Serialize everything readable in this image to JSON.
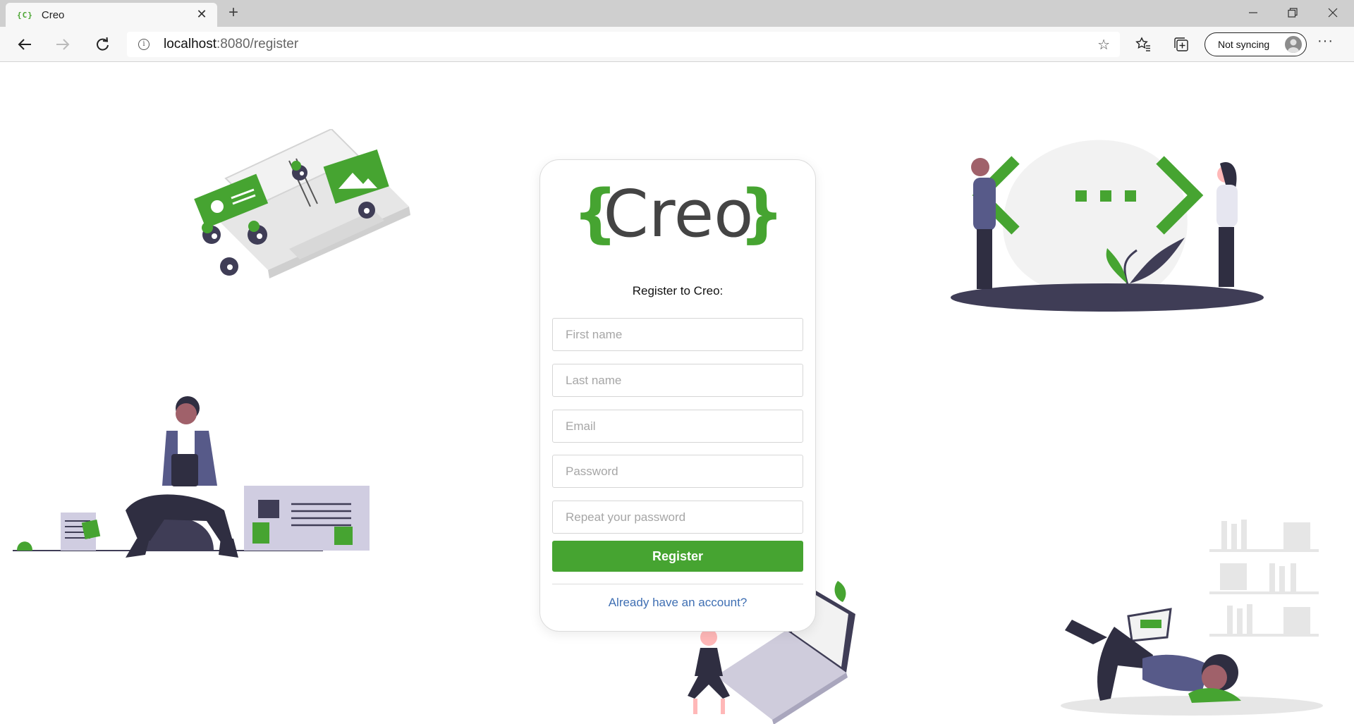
{
  "browser": {
    "tab_title": "Creo",
    "tab_favicon": "{C}",
    "address_host": "localhost",
    "address_path": ":8080/register",
    "sync_label": "Not syncing",
    "more_label": "···"
  },
  "icons": {
    "back": "arrow-left-icon",
    "forward": "arrow-right-icon",
    "refresh": "refresh-icon",
    "info": "info-icon",
    "favorite": "star-icon",
    "favorites_list": "favorites-icon",
    "collections": "collections-icon",
    "profile": "profile-icon"
  },
  "logo": {
    "text": "Creo",
    "brace_open": "{",
    "brace_close": "}",
    "brace_color": "#46a431",
    "text_color": "#444444"
  },
  "form": {
    "heading": "Register to Creo:",
    "first_name_placeholder": "First name",
    "last_name_placeholder": "Last name",
    "email_placeholder": "Email",
    "password_placeholder": "Password",
    "repeat_password_placeholder": "Repeat your password",
    "submit_label": "Register",
    "login_link": "Already have an account?"
  },
  "colors": {
    "accent": "#46a431",
    "link": "#3f6fb3",
    "illustration_dark": "#3f3d56",
    "illustration_light": "#e6e6e6"
  }
}
